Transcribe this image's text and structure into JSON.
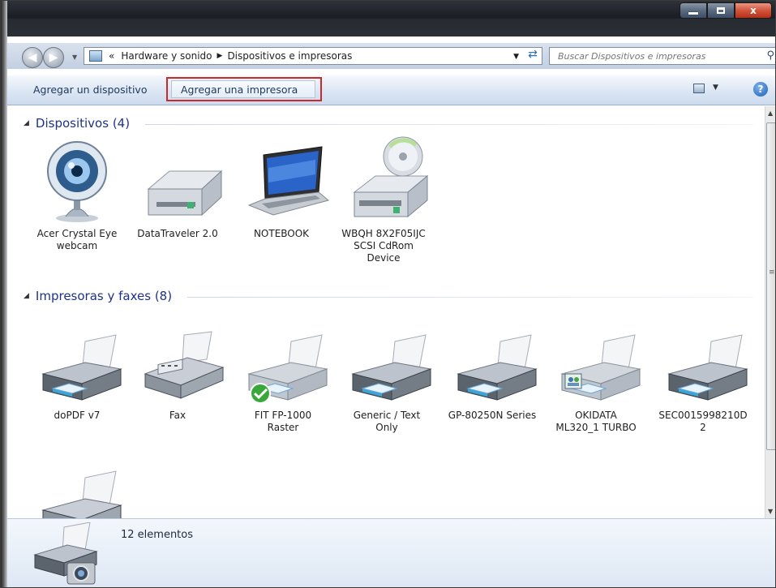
{
  "window": {
    "caption_buttons": [
      "minimize",
      "maximize",
      "close"
    ],
    "close_glyph": "x"
  },
  "nav": {
    "back_icon": "back-arrow",
    "forward_icon": "forward-arrow",
    "chevrons": "«",
    "breadcrumb": [
      "Hardware y sonido",
      "Dispositivos e impresoras"
    ],
    "search_placeholder": "Buscar Dispositivos e impresoras"
  },
  "commands": {
    "add_device": "Agregar un dispositivo",
    "add_printer": "Agregar una impresora",
    "highlight_color": "#cc2a2a"
  },
  "groups": [
    {
      "title": "Dispositivos (4)",
      "items": [
        {
          "label": "Acer Crystal Eye\nwebcam",
          "icon": "webcam-icon"
        },
        {
          "label": "DataTraveler 2.0",
          "icon": "drive-icon"
        },
        {
          "label": "NOTEBOOK",
          "icon": "laptop-icon"
        },
        {
          "label": "WBQH 8X2F05IJC\nSCSI CdRom\nDevice",
          "icon": "cdrom-icon"
        }
      ]
    },
    {
      "title": "Impresoras y faxes (8)",
      "items": [
        {
          "label": "doPDF v7",
          "icon": "printer-icon"
        },
        {
          "label": "Fax",
          "icon": "fax-icon"
        },
        {
          "label": "FIT FP-1000\nRaster",
          "icon": "printer-default-icon"
        },
        {
          "label": "Generic / Text\nOnly",
          "icon": "printer-icon"
        },
        {
          "label": "GP-80250N Series",
          "icon": "printer-icon"
        },
        {
          "label": "OKIDATA\nML320_1 TURBO",
          "icon": "printer-shared-icon"
        },
        {
          "label": "SEC0015998210D\n2",
          "icon": "printer-icon"
        },
        {
          "label": "",
          "icon": "printer-icon"
        }
      ]
    }
  ],
  "details": {
    "count": "12 elementos",
    "icon": "printer-camera-icon"
  },
  "colors": {
    "group_header": "#1e3287",
    "accent": "#2c6bbd"
  }
}
